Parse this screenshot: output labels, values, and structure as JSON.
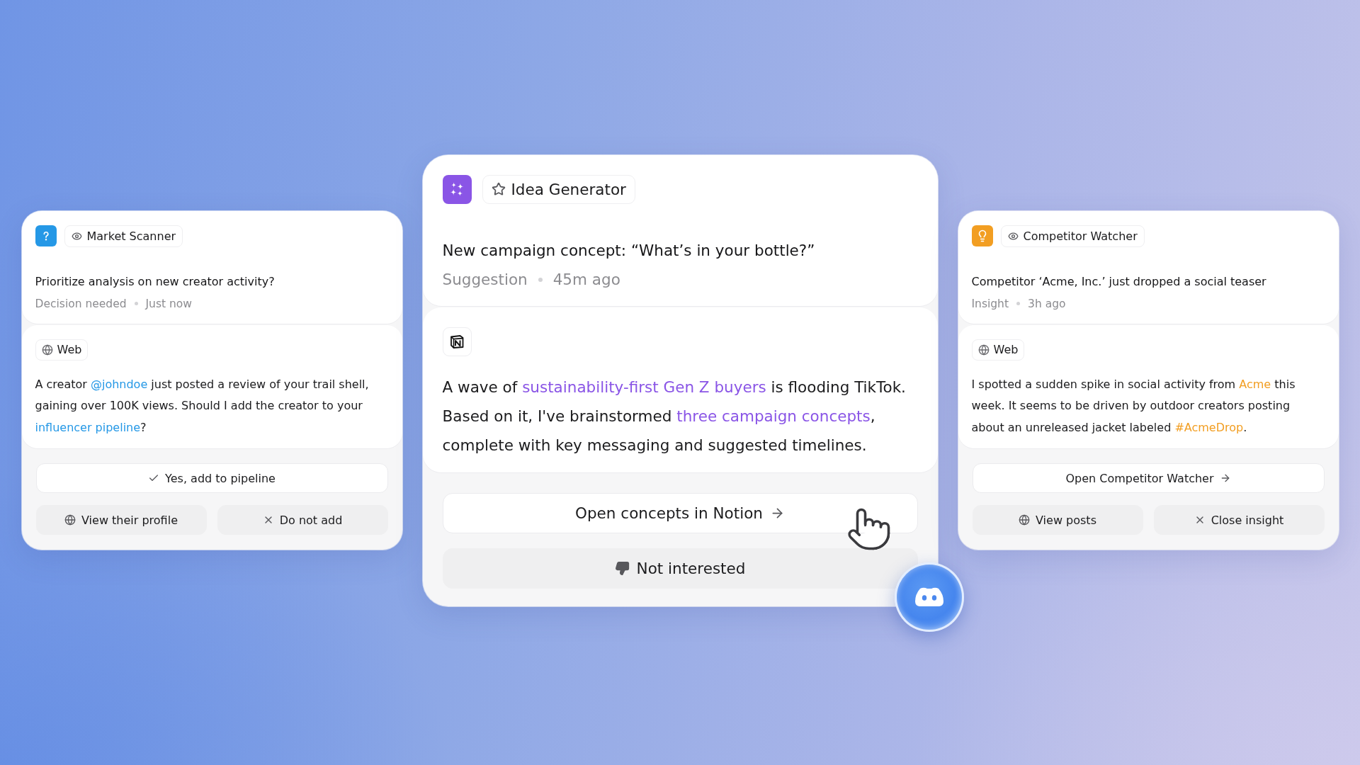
{
  "cards": [
    {
      "kind": "decision",
      "featured": false,
      "color": "#2598e6",
      "agent": "Market Scanner",
      "title": "Prioritize analysis on new creator activity?",
      "category": "Decision needed",
      "time": "Just now",
      "source": {
        "kind": "web",
        "label": "Web"
      },
      "message": [
        {
          "kind": "text",
          "text": "A creator "
        },
        {
          "kind": "link",
          "text": "@johndoe"
        },
        {
          "kind": "text",
          "text": " just posted a review of your trail shell, gaining over 100K views. Should I add the creator to your "
        },
        {
          "kind": "link",
          "text": "influencer pipeline"
        },
        {
          "kind": "text",
          "text": "?"
        }
      ],
      "actions": [
        {
          "kind": "confirm",
          "label": "Yes, add to pipeline"
        },
        {
          "kind": "browse",
          "label": "View their profile"
        },
        {
          "kind": "dismiss",
          "label": "Do not add"
        }
      ]
    },
    {
      "kind": "suggestion",
      "featured": true,
      "color": "#8a55e6",
      "agent": "Idea Generator",
      "title": "New campaign concept: “What’s in your bottle?”",
      "category": "Suggestion",
      "time": "45m ago",
      "source": {
        "kind": "notion"
      },
      "message": [
        {
          "kind": "text",
          "text": "A wave of "
        },
        {
          "kind": "link",
          "text": "sustainability-first Gen Z buyers"
        },
        {
          "kind": "text",
          "text": " is flooding TikTok. Based on it, I've brainstormed "
        },
        {
          "kind": "link",
          "text": "three campaign concepts"
        },
        {
          "kind": "text",
          "text": ", complete with key messaging and suggested timelines."
        }
      ],
      "actions": [
        {
          "kind": "open",
          "label": "Open concepts in Notion"
        },
        {
          "kind": "reject",
          "label": "Not interested"
        }
      ]
    },
    {
      "kind": "insight",
      "featured": false,
      "color": "#f29e22",
      "agent": "Competitor Watcher",
      "title": "Competitor ‘Acme, Inc.’ just dropped a social teaser",
      "category": "Insight",
      "time": "3h ago",
      "source": {
        "kind": "web",
        "label": "Web"
      },
      "message": [
        {
          "kind": "text",
          "text": "I spotted a sudden spike in social activity from "
        },
        {
          "kind": "link",
          "text": "Acme"
        },
        {
          "kind": "text",
          "text": " this week. It seems to be driven by outdoor creators posting about an unreleased jacket labeled "
        },
        {
          "kind": "link",
          "text": "#AcmeDrop"
        },
        {
          "kind": "text",
          "text": "."
        }
      ],
      "actions": [
        {
          "kind": "open",
          "label": "Open Competitor Watcher"
        },
        {
          "kind": "browse",
          "label": "View posts"
        },
        {
          "kind": "dismiss",
          "label": "Close insight"
        }
      ]
    }
  ]
}
